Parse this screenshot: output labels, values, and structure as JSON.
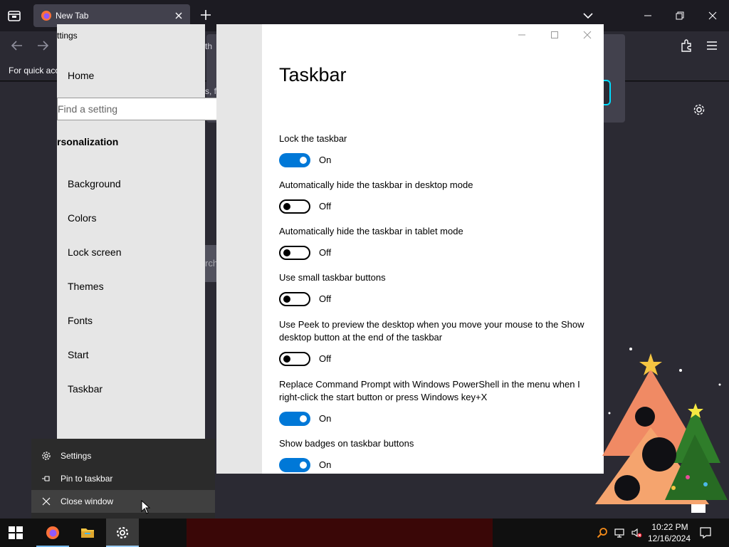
{
  "firefox": {
    "tab_title": "New Tab",
    "bookmarks_hint": "For quick acc",
    "fragment_th": "th",
    "fragment_f": "s, fi",
    "fragment_rch": "rch"
  },
  "settings": {
    "window_title_fragment": "ttings",
    "nav": {
      "home": "Home",
      "search_placeholder": "Find a setting",
      "section_heading": "rsonalization",
      "items": [
        "Background",
        "Colors",
        "Lock screen",
        "Themes",
        "Fonts",
        "Start",
        "Taskbar"
      ]
    },
    "page_title": "Taskbar",
    "options": [
      {
        "label": "Lock the taskbar",
        "state": "On"
      },
      {
        "label": "Automatically hide the taskbar in desktop mode",
        "state": "Off"
      },
      {
        "label": "Automatically hide the taskbar in tablet mode",
        "state": "Off"
      },
      {
        "label": "Use small taskbar buttons",
        "state": "Off"
      },
      {
        "label": "Use Peek to preview the desktop when you move your mouse to the Show desktop button at the end of the taskbar",
        "state": "Off"
      },
      {
        "label": "Replace Command Prompt with Windows PowerShell in the menu when I right-click the start button or press Windows key+X",
        "state": "On"
      },
      {
        "label": "Show badges on taskbar buttons",
        "state": "On"
      }
    ]
  },
  "jumplist": {
    "items": [
      {
        "label": "Settings",
        "icon": "gear-icon"
      },
      {
        "label": "Pin to taskbar",
        "icon": "pin-icon"
      },
      {
        "label": "Close window",
        "icon": "close-icon"
      }
    ]
  },
  "taskbar": {
    "time": "10:22 PM",
    "date": "12/16/2024"
  },
  "colors": {
    "accent": "#0078d7",
    "firefox_focus": "#00ddff"
  }
}
